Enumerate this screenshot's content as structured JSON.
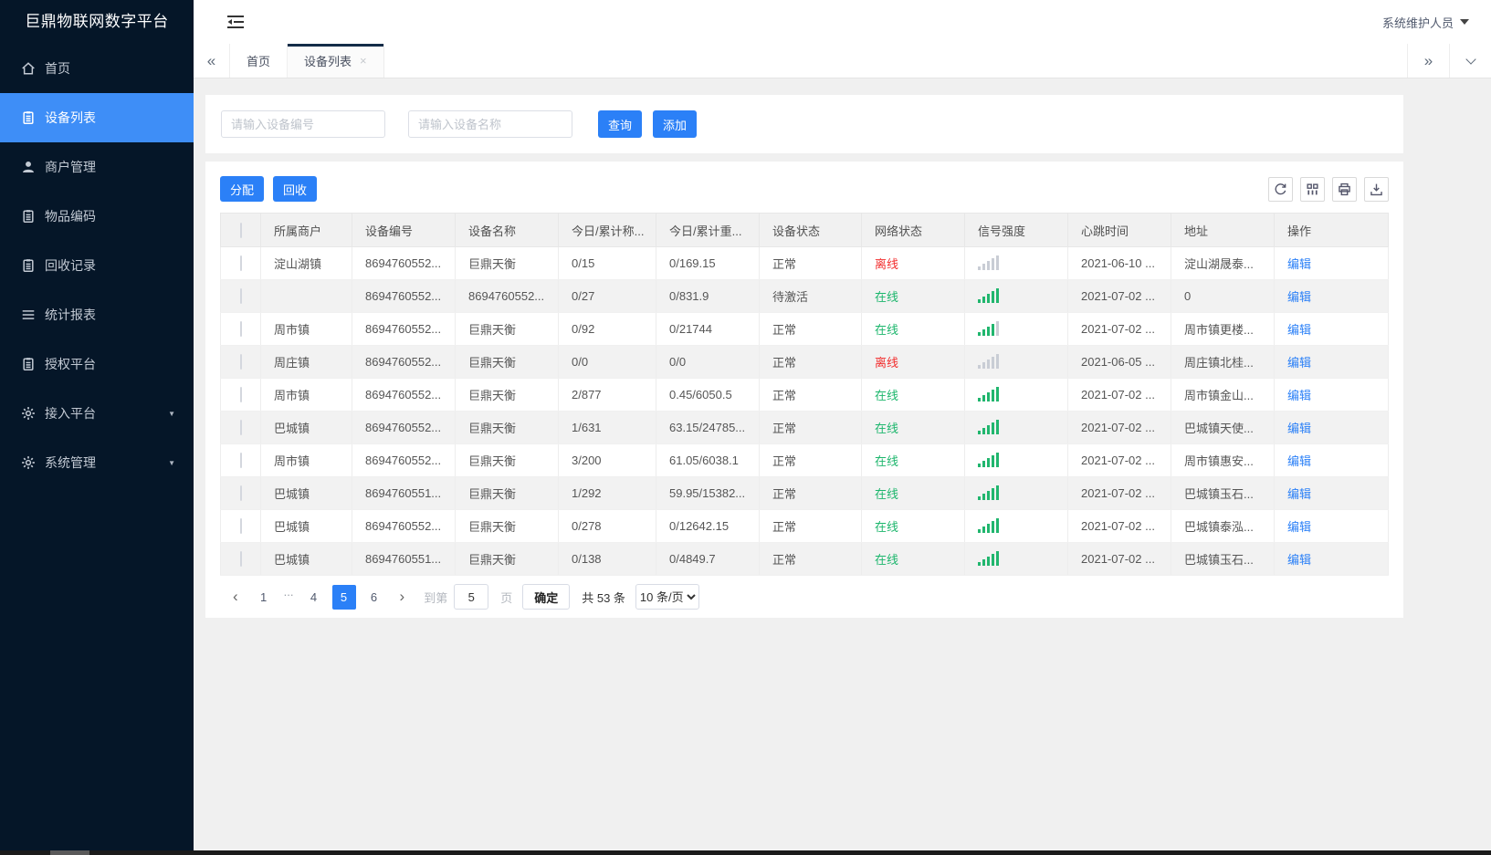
{
  "colors": {
    "sidebar_bg": "#051628",
    "accent_blue": "#3e8ef7",
    "button_blue": "#2b80f7",
    "online_green": "#1cb66c",
    "offline_red": "#f22e2e",
    "link_blue": "#2b80f7"
  },
  "sidebar": {
    "title": "巨鼎物联网数字平台",
    "items": [
      {
        "key": "home",
        "label": "首页",
        "icon": "home-icon",
        "active": false,
        "expandable": false
      },
      {
        "key": "device-list",
        "label": "设备列表",
        "icon": "clipboard-icon",
        "active": true,
        "expandable": false
      },
      {
        "key": "merchant-management",
        "label": "商户管理",
        "icon": "user-icon",
        "active": false,
        "expandable": false
      },
      {
        "key": "item-code",
        "label": "物品编码",
        "icon": "clipboard-icon",
        "active": false,
        "expandable": false
      },
      {
        "key": "recycle-record",
        "label": "回收记录",
        "icon": "clipboard-icon",
        "active": false,
        "expandable": false
      },
      {
        "key": "statistics-report",
        "label": "统计报表",
        "icon": "list-icon",
        "active": false,
        "expandable": false
      },
      {
        "key": "authorize-platform",
        "label": "授权平台",
        "icon": "clipboard-icon",
        "active": false,
        "expandable": false
      },
      {
        "key": "access-platform",
        "label": "接入平台",
        "icon": "gear-icon",
        "active": false,
        "expandable": true
      },
      {
        "key": "system-management",
        "label": "系统管理",
        "icon": "gear-icon",
        "active": false,
        "expandable": true
      }
    ]
  },
  "header": {
    "user": "系统维护人员"
  },
  "tabs": [
    {
      "key": "home",
      "label": "首页",
      "active": false,
      "closable": false
    },
    {
      "key": "device-list",
      "label": "设备列表",
      "active": true,
      "closable": true
    }
  ],
  "search": {
    "device_no_placeholder": "请输入设备编号",
    "device_name_placeholder": "请输入设备名称",
    "query_label": "查询",
    "add_label": "添加"
  },
  "toolbar": {
    "assign_label": "分配",
    "recycle_label": "回收",
    "icons": [
      "refresh-icon",
      "columns-icon",
      "print-icon",
      "download-icon"
    ]
  },
  "table": {
    "columns": [
      "所属商户",
      "设备编号",
      "设备名称",
      "今日/累计称...",
      "今日/累计重...",
      "设备状态",
      "网络状态",
      "信号强度",
      "心跳时间",
      "地址",
      "操作"
    ],
    "rows": [
      {
        "merchant": "淀山湖镇",
        "device_no": "8694760552...",
        "device_name": "巨鼎天衡",
        "today_count": "0/15",
        "today_weight": "0/169.15",
        "device_status": "正常",
        "network_status": "离线",
        "online": false,
        "signal": 0,
        "heartbeat": "2021-06-10 ...",
        "address": "淀山湖晟泰...",
        "action": "编辑"
      },
      {
        "merchant": "",
        "device_no": "8694760552...",
        "device_name": "8694760552...",
        "today_count": "0/27",
        "today_weight": "0/831.9",
        "device_status": "待激活",
        "network_status": "在线",
        "online": true,
        "signal": 5,
        "heartbeat": "2021-07-02 ...",
        "address": "0",
        "action": "编辑"
      },
      {
        "merchant": "周市镇",
        "device_no": "8694760552...",
        "device_name": "巨鼎天衡",
        "today_count": "0/92",
        "today_weight": "0/21744",
        "device_status": "正常",
        "network_status": "在线",
        "online": true,
        "signal": 4,
        "heartbeat": "2021-07-02 ...",
        "address": "周市镇更楼...",
        "action": "编辑"
      },
      {
        "merchant": "周庄镇",
        "device_no": "8694760552...",
        "device_name": "巨鼎天衡",
        "today_count": "0/0",
        "today_weight": "0/0",
        "device_status": "正常",
        "network_status": "离线",
        "online": false,
        "signal": 0,
        "heartbeat": "2021-06-05 ...",
        "address": "周庄镇北桂...",
        "action": "编辑"
      },
      {
        "merchant": "周市镇",
        "device_no": "8694760552...",
        "device_name": "巨鼎天衡",
        "today_count": "2/877",
        "today_weight": "0.45/6050.5",
        "device_status": "正常",
        "network_status": "在线",
        "online": true,
        "signal": 5,
        "heartbeat": "2021-07-02 ...",
        "address": "周市镇金山...",
        "action": "编辑"
      },
      {
        "merchant": "巴城镇",
        "device_no": "8694760552...",
        "device_name": "巨鼎天衡",
        "today_count": "1/631",
        "today_weight": "63.15/24785...",
        "device_status": "正常",
        "network_status": "在线",
        "online": true,
        "signal": 5,
        "heartbeat": "2021-07-02 ...",
        "address": "巴城镇天使...",
        "action": "编辑"
      },
      {
        "merchant": "周市镇",
        "device_no": "8694760552...",
        "device_name": "巨鼎天衡",
        "today_count": "3/200",
        "today_weight": "61.05/6038.1",
        "device_status": "正常",
        "network_status": "在线",
        "online": true,
        "signal": 5,
        "heartbeat": "2021-07-02 ...",
        "address": "周市镇惠安...",
        "action": "编辑"
      },
      {
        "merchant": "巴城镇",
        "device_no": "8694760551...",
        "device_name": "巨鼎天衡",
        "today_count": "1/292",
        "today_weight": "59.95/15382...",
        "device_status": "正常",
        "network_status": "在线",
        "online": true,
        "signal": 5,
        "heartbeat": "2021-07-02 ...",
        "address": "巴城镇玉石...",
        "action": "编辑"
      },
      {
        "merchant": "巴城镇",
        "device_no": "8694760552...",
        "device_name": "巨鼎天衡",
        "today_count": "0/278",
        "today_weight": "0/12642.15",
        "device_status": "正常",
        "network_status": "在线",
        "online": true,
        "signal": 5,
        "heartbeat": "2021-07-02 ...",
        "address": "巴城镇泰泓...",
        "action": "编辑"
      },
      {
        "merchant": "巴城镇",
        "device_no": "8694760551...",
        "device_name": "巨鼎天衡",
        "today_count": "0/138",
        "today_weight": "0/4849.7",
        "device_status": "正常",
        "network_status": "在线",
        "online": true,
        "signal": 5,
        "heartbeat": "2021-07-02 ...",
        "address": "巴城镇玉石...",
        "action": "编辑"
      }
    ]
  },
  "pagination": {
    "pages": [
      "1",
      "...",
      "4",
      "5",
      "6"
    ],
    "active_page": "5",
    "goto_label": "到第",
    "goto_value": "5",
    "page_unit": "页",
    "confirm_label": "确定",
    "total_label": "共 53 条",
    "page_size": "10 条/页"
  }
}
